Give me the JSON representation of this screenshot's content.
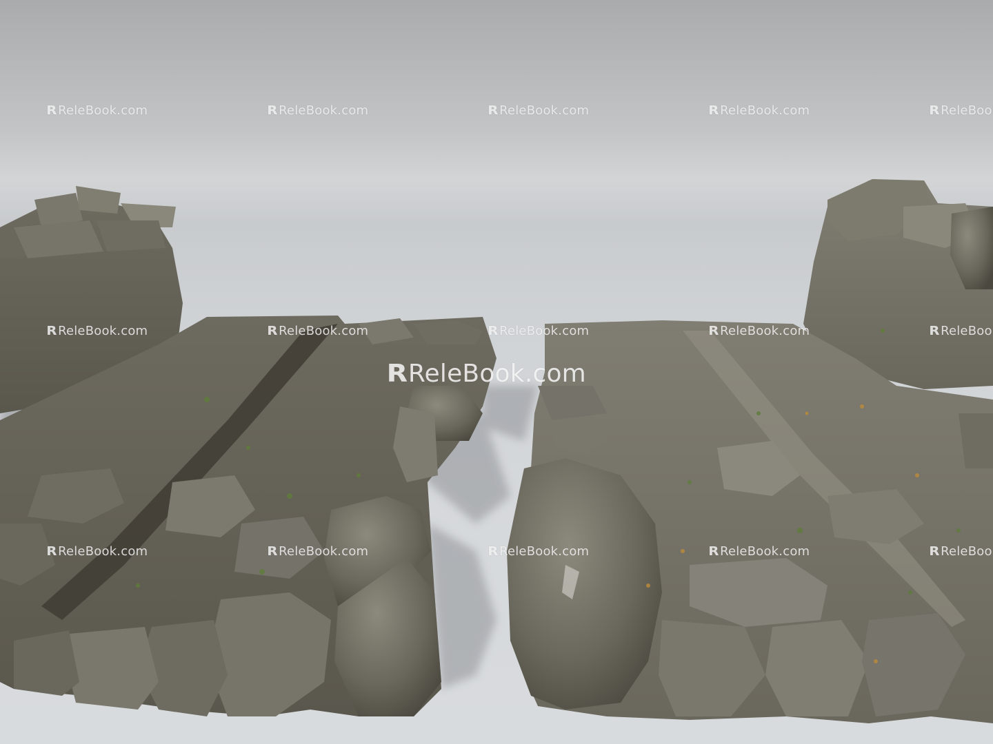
{
  "watermark": {
    "text": "ReleBook.com",
    "mark": "R"
  },
  "colors": {
    "background_top": "#a9abac",
    "background_floor": "#d6d9dc",
    "rock_dark": "#4e4b42",
    "rock_mid": "#6a675c",
    "rock_light": "#8a877b",
    "moss": "#5f7d3a",
    "leaf": "#b98a3c"
  }
}
